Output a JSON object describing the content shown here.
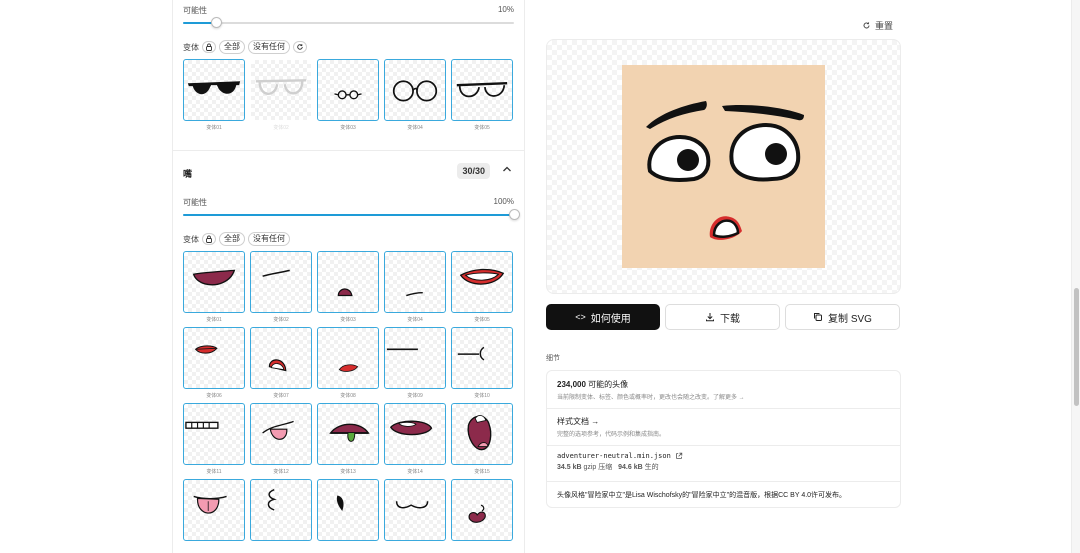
{
  "glasses_section": {
    "probability_label": "可能性",
    "probability_value": "10%",
    "probability": 0.1,
    "variant_label": "变体",
    "chip_all": "全部",
    "chip_none": "没有任何",
    "tiles": [
      {
        "label": "变体01",
        "enabled": true
      },
      {
        "label": "变体02",
        "enabled": false
      },
      {
        "label": "变体03",
        "enabled": true
      },
      {
        "label": "变体04",
        "enabled": true
      },
      {
        "label": "变体05",
        "enabled": true
      }
    ]
  },
  "mouth_section": {
    "title": "嘴",
    "count": "30/30",
    "probability_label": "可能性",
    "probability_value": "100%",
    "probability": 1.0,
    "variant_label": "变体",
    "chip_all": "全部",
    "chip_none": "没有任何",
    "tiles": [
      {
        "label": "变体01"
      },
      {
        "label": "变体02"
      },
      {
        "label": "变体03"
      },
      {
        "label": "变体04"
      },
      {
        "label": "变体05"
      },
      {
        "label": "变体06"
      },
      {
        "label": "变体07"
      },
      {
        "label": "变体08"
      },
      {
        "label": "变体09"
      },
      {
        "label": "变体10"
      },
      {
        "label": "变体11"
      },
      {
        "label": "变体12"
      },
      {
        "label": "变体13"
      },
      {
        "label": "变体14"
      },
      {
        "label": "变体15"
      },
      {
        "label": ""
      },
      {
        "label": ""
      },
      {
        "label": ""
      },
      {
        "label": ""
      },
      {
        "label": ""
      }
    ]
  },
  "preview": {
    "reset_label": "重置",
    "skin_color": "#f2d3b1"
  },
  "actions": {
    "how_to_use": "如何使用",
    "download": "下载",
    "copy_svg": "复制 SVG"
  },
  "details": {
    "title": "细节",
    "avatars_count": "234,000",
    "avatars_label": "可能的头像",
    "avatars_desc": "当前限制变体、标签、颜色或概率时，更改也会随之改变。了解更多 →",
    "style_docs_title": "样式文档 →",
    "style_docs_desc": "完整的选项参考，代码示例和集成指南。",
    "file_name": "adventurer-neutral.min.json",
    "file_size_gzip": "34.5 kB",
    "file_size_gzip_label": "gzip 压缩",
    "file_size_raw": "94.6 kB",
    "file_size_raw_label": "生的",
    "license_text": "头像风格\"冒险家中立\"是Lisa Wischofsky的\"冒险家中立\"的混音版，根据CC BY 4.0许可发布。"
  },
  "colors": {
    "accent": "#1e9bd7",
    "tile_border": "#3aa9dd",
    "primary_button": "#111111",
    "lip_red": "#d62d2d",
    "mouth_plum": "#8c2a4b"
  }
}
